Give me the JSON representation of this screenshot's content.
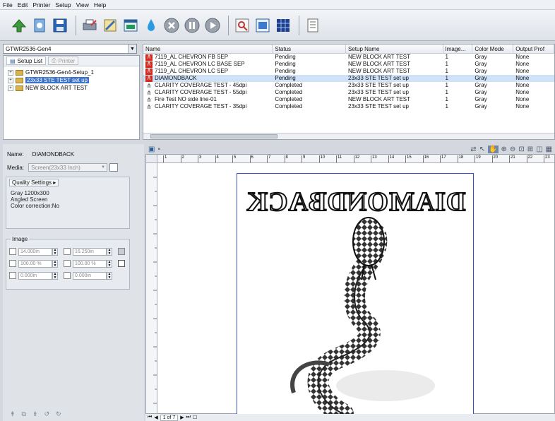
{
  "menu": [
    "File",
    "Edit",
    "Printer",
    "Setup",
    "View",
    "Help"
  ],
  "toolbar_icons": [
    "add-job-icon",
    "job-settings-icon",
    "save-icon",
    "printer-settings-icon",
    "setup-icon",
    "layout-icon",
    "ink-icon",
    "stop-icon",
    "pause-icon",
    "play-icon",
    "zoom-icon",
    "preview-icon",
    "grid-icon",
    "queue-icon"
  ],
  "printer": {
    "selected": "GTWR2536-Gen4"
  },
  "tree": {
    "tabs": [
      "Setup List",
      "Printer"
    ],
    "items": [
      {
        "label": "GTWR2536-Gen4-Setup_1",
        "selected": false
      },
      {
        "label": "23x33 STE TEST set up",
        "selected": true
      },
      {
        "label": "NEW BLOCK ART TEST",
        "selected": false
      }
    ]
  },
  "jobs": {
    "columns": [
      "Name",
      "Status",
      "Setup Name",
      "Image...",
      "Color Mode",
      "Output Prof"
    ],
    "rows": [
      {
        "name": "7119_AL CHEVRON FB SEP",
        "status": "Pending",
        "setup": "NEW BLOCK ART TEST",
        "image": "1",
        "color": "Gray",
        "output": "None",
        "icon": "pending-job-icon",
        "selected": false
      },
      {
        "name": "7119_AL CHEVRON LC BASE SEP",
        "status": "Pending",
        "setup": "NEW BLOCK ART TEST",
        "image": "1",
        "color": "Gray",
        "output": "None",
        "icon": "pending-job-icon",
        "selected": false
      },
      {
        "name": "7119_AL CHEVRON LC SEP",
        "status": "Pending",
        "setup": "NEW BLOCK ART TEST",
        "image": "1",
        "color": "Gray",
        "output": "None",
        "icon": "pending-job-icon",
        "selected": false
      },
      {
        "name": "DIAMONDBACK",
        "status": "Pending",
        "setup": "23x33 STE TEST set up",
        "image": "1",
        "color": "Gray",
        "output": "None",
        "icon": "pending-job-icon",
        "selected": true
      },
      {
        "name": "CLARITY COVERAGE TEST - 45dpi",
        "status": "Completed",
        "setup": "23x33 STE TEST set up",
        "image": "1",
        "color": "Gray",
        "output": "None",
        "icon": "completed-job-icon",
        "selected": false
      },
      {
        "name": "CLARITY COVERAGE TEST - 55dpi",
        "status": "Completed",
        "setup": "23x33 STE TEST set up",
        "image": "1",
        "color": "Gray",
        "output": "None",
        "icon": "completed-job-icon",
        "selected": false
      },
      {
        "name": "Fire Test NO side line-01",
        "status": "Completed",
        "setup": "NEW BLOCK ART TEST",
        "image": "1",
        "color": "Gray",
        "output": "None",
        "icon": "completed-job-icon",
        "selected": false
      },
      {
        "name": "CLARITY COVERAGE TEST - 35dpi",
        "status": "Completed",
        "setup": "23x33 STE TEST set up",
        "image": "1",
        "color": "Gray",
        "output": "None",
        "icon": "completed-job-icon",
        "selected": false
      }
    ]
  },
  "props": {
    "name_label": "Name:",
    "name_value": "DIAMONDBACK",
    "media_label": "Media:",
    "media_value": "Screen(23x33 Inch)",
    "quality_title": "Quality Settings",
    "quality_lines": [
      "Gray 1200x300",
      "Angled Screen",
      "Color correction:No"
    ],
    "image_title": "Image",
    "width": "14.000in",
    "height": "16.250in",
    "scale_x": "100.00 %",
    "scale_y": "100.00 %",
    "pos_x": "0.000in",
    "pos_y": "0.000in"
  },
  "preview": {
    "artwork_title": "DIAMONDBACK",
    "ruler_marks": [
      "1",
      "2",
      "3",
      "4",
      "5",
      "6",
      "7",
      "8",
      "9",
      "10",
      "11",
      "12",
      "13",
      "14",
      "15",
      "16",
      "17",
      "18",
      "19",
      "20",
      "21",
      "22",
      "23"
    ],
    "page_indicator": "1 of 7"
  },
  "colors": {
    "selection": "#3a73c9",
    "row_highlight": "#cfe2f7",
    "pending_icon": "#d42a1f",
    "page_border": "#3b4fbf"
  }
}
